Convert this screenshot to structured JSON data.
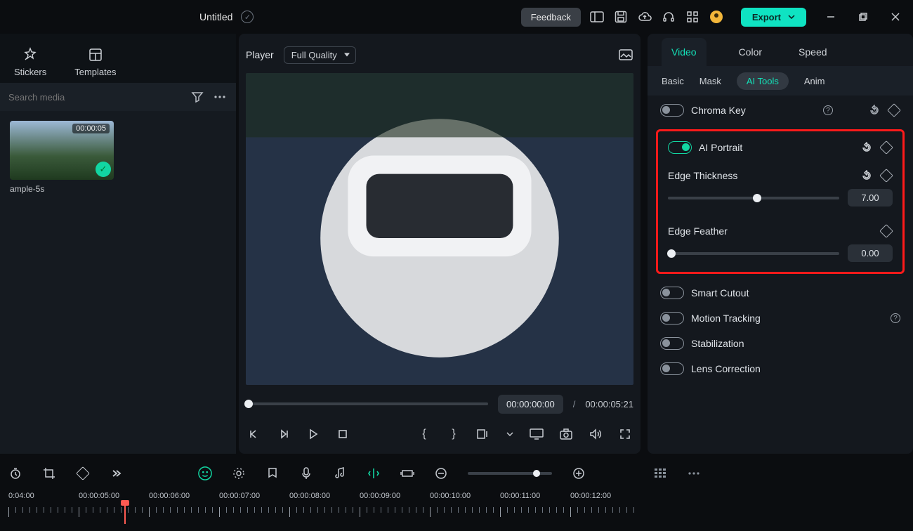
{
  "header": {
    "title": "Untitled",
    "feedback": "Feedback",
    "export": "Export"
  },
  "left": {
    "tabs": {
      "stickers": "Stickers",
      "templates": "Templates"
    },
    "search_placeholder": "Search media",
    "clip": {
      "duration": "00:00:05",
      "name": "ample-5s"
    }
  },
  "center": {
    "player_label": "Player",
    "quality": "Full Quality",
    "time_current": "00:00:00:00",
    "time_sep": "/",
    "time_total": "00:00:05:21"
  },
  "right": {
    "tabs": {
      "video": "Video",
      "color": "Color",
      "speed": "Speed"
    },
    "subtabs": {
      "basic": "Basic",
      "mask": "Mask",
      "aitools": "AI Tools",
      "anim": "Anim"
    },
    "chroma": "Chroma Key",
    "ai_portrait": "AI Portrait",
    "edge_thickness": {
      "label": "Edge Thickness",
      "value": "7.00"
    },
    "edge_feather": {
      "label": "Edge Feather",
      "value": "0.00"
    },
    "smart_cutout": "Smart Cutout",
    "motion_tracking": "Motion Tracking",
    "stabilization": "Stabilization",
    "lens_correction": "Lens Correction"
  },
  "timeline": {
    "labels": [
      "0:04:00",
      "00:00:05:00",
      "00:00:06:00",
      "00:00:07:00",
      "00:00:08:00",
      "00:00:09:00",
      "00:00:10:00",
      "00:00:11:00",
      "00:00:12:00"
    ]
  }
}
